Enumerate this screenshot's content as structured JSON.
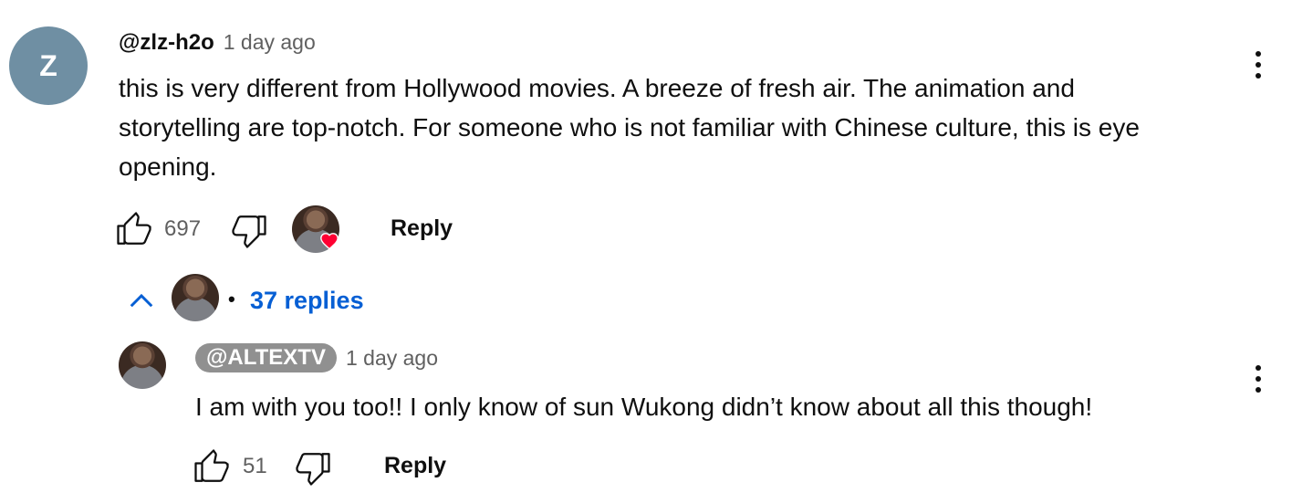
{
  "comment": {
    "avatar_letter": "Z",
    "author": "@zlz-h2o",
    "time": "1 day ago",
    "text_lines": [
      "this is very different from Hollywood movies. A breeze of fresh air. The animation and",
      "storytelling are top-notch. For someone who is not familiar with Chinese culture, this is eye",
      "opening."
    ],
    "likes": "697",
    "reply_label": "Reply",
    "replies_label": "37 replies",
    "separator": "•"
  },
  "reply": {
    "author": "@ALTEXTV",
    "time": "1 day ago",
    "text": "I am with you too!! I only know of sun Wukong didn’t know about all this though!",
    "likes": "51",
    "reply_label": "Reply"
  },
  "icons": {
    "like": "thumbs-up-icon",
    "dislike": "thumbs-down-icon",
    "menu": "more-vert-icon",
    "collapse": "chevron-up-icon",
    "creator_heart": "heart-icon"
  },
  "colors": {
    "link_blue": "#065fd4",
    "heart_red": "#ff0033",
    "avatar_z": "#6f8fa3",
    "handle_pill": "#909090"
  }
}
